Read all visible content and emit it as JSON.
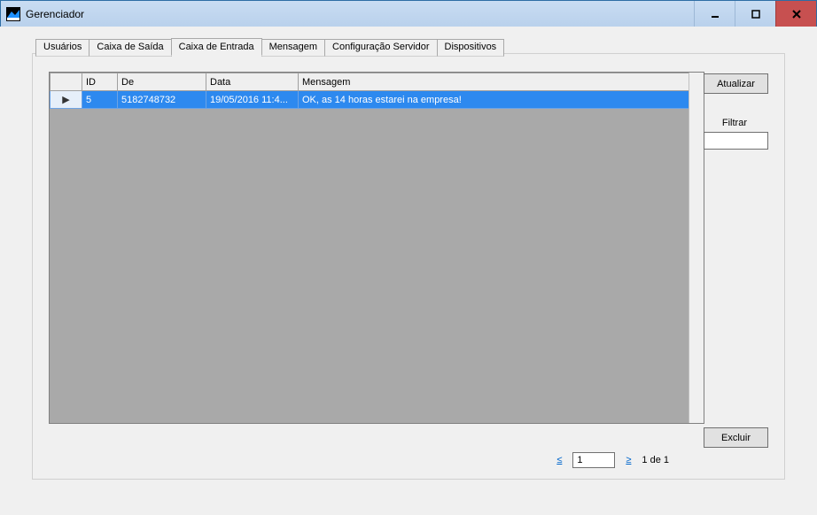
{
  "window": {
    "title": "Gerenciador"
  },
  "tabs": [
    {
      "label": "Usuários",
      "active": false
    },
    {
      "label": "Caixa de Saída",
      "active": false
    },
    {
      "label": "Caixa de Entrada",
      "active": true
    },
    {
      "label": "Mensagem",
      "active": false
    },
    {
      "label": "Configuração Servidor",
      "active": false
    },
    {
      "label": "Dispositivos",
      "active": false
    }
  ],
  "grid": {
    "columns": [
      "",
      "ID",
      "De",
      "Data",
      "Mensagem"
    ],
    "rows": [
      {
        "indicator": "▶",
        "id": "5",
        "de": "5182748732",
        "data": "19/05/2016 11:4...",
        "mensagem": "OK, as 14 horas estarei na empresa!"
      }
    ]
  },
  "buttons": {
    "atualizar": "Atualizar",
    "excluir": "Excluir"
  },
  "filter": {
    "label": "Filtrar",
    "value": ""
  },
  "pager": {
    "prev": "≤",
    "page": "1",
    "next": "≥",
    "status": "1 de 1"
  }
}
